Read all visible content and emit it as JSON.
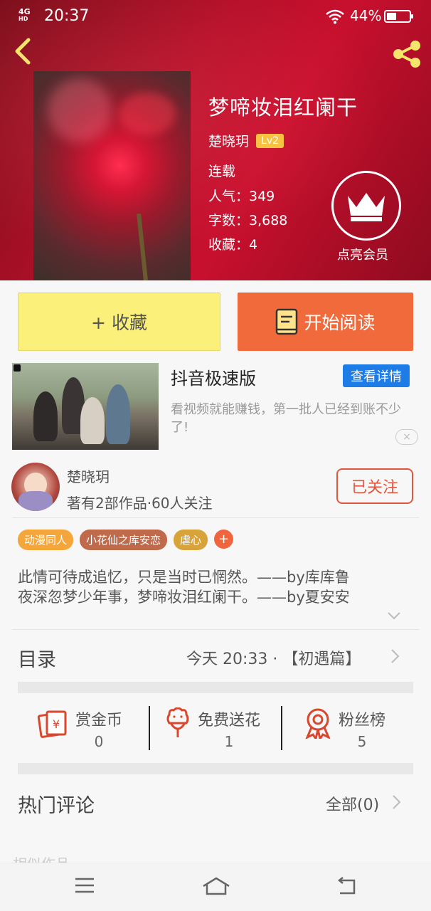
{
  "statusbar": {
    "network": "4G",
    "network_sub": "HD",
    "time": "20:37",
    "battery": "44%"
  },
  "book": {
    "title": "梦啼妆泪红阑干",
    "author": "楚晓玥",
    "level": "Lv2",
    "status": "连载",
    "popularity": "人气：349",
    "words": "字数：3,688",
    "favorites": "收藏：4"
  },
  "vip": {
    "label": "点亮会员"
  },
  "actions": {
    "collect": "+ 收藏",
    "read": "开始阅读"
  },
  "ad": {
    "title": "抖音极速版",
    "detail_button": "查看详情",
    "description": "看视频就能赚钱，第一批人已经到账不少了!",
    "close": "×"
  },
  "author_card": {
    "name": "楚晓玥",
    "stats": "著有2部作品·60人关注",
    "follow_button": "已关注"
  },
  "tags": [
    {
      "label": "动漫同人",
      "color": "#f4a63a"
    },
    {
      "label": "小花仙之库安恋",
      "color": "#c06a4c"
    },
    {
      "label": "虐心",
      "color": "#d8a43a"
    }
  ],
  "intro": [
    "此情可待成追忆，只是当时已惘然。——by库库鲁",
    "夜深忽梦少年事，梦啼妆泪红阑干。——by夏安安"
  ],
  "catalog": {
    "title": "目录",
    "latest": "今天 20:33 · 【初遇篇】"
  },
  "rewards": [
    {
      "label": "赏金币",
      "value": "0"
    },
    {
      "label": "免费送花",
      "value": "1"
    },
    {
      "label": "粉丝榜",
      "value": "5"
    }
  ],
  "comments": {
    "title": "热门评论",
    "all": "全部(0)"
  },
  "next_section": {
    "title": "相似作品"
  },
  "colors": {
    "accent": "#e2563b",
    "hero": "#b5102a",
    "collect": "#fbf07a",
    "read": "#f06a3c",
    "ad_button": "#1e7ce6"
  }
}
